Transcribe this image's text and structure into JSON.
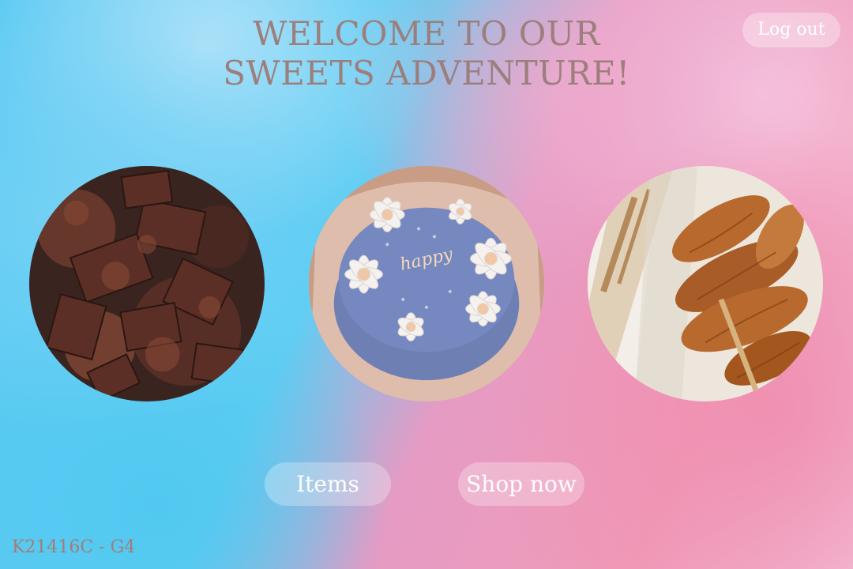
{
  "header": {
    "title_line1": "WELCOME TO OUR",
    "title_line2": "SWEETS ADVENTURE!",
    "logout_label": "Log out"
  },
  "gallery": [
    {
      "name": "chocolate-image"
    },
    {
      "name": "cake-image",
      "cake_text": "happy"
    },
    {
      "name": "croissants-image"
    }
  ],
  "actions": {
    "items_label": "Items",
    "shop_label": "Shop now"
  },
  "footer": {
    "text": "K21416C - G4"
  },
  "colors": {
    "title": "#9c7f7d",
    "footer": "#a27d78",
    "button_text": "#ffffff"
  }
}
